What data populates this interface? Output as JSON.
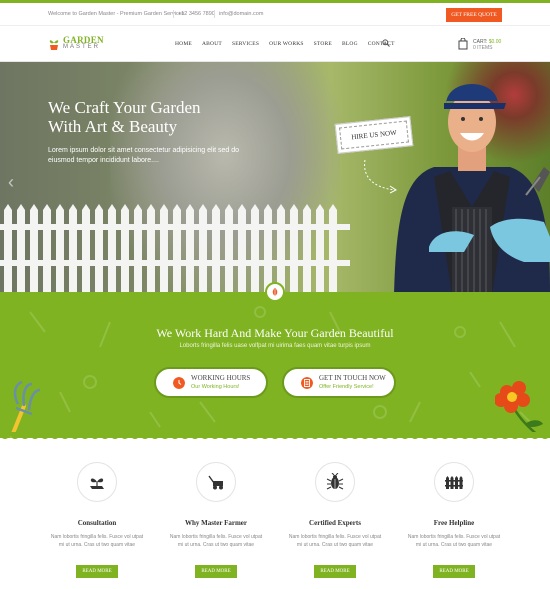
{
  "topbar": {
    "welcome": "Welcome to Garden Master - Premium Garden Services",
    "phone": "+12 3456 7890",
    "email": "info@domain.com",
    "quote_button": "GET FREE QUOTE"
  },
  "header": {
    "logo_line1": "GARDEN",
    "logo_line2": "MASTER",
    "nav": [
      "HOME",
      "ABOUT",
      "SERVICES",
      "OUR WORKS",
      "STORE",
      "BLOG",
      "CONTACT"
    ],
    "cart_label": "CART:",
    "cart_amount": "$0.00",
    "cart_items": "0 ITEMS"
  },
  "hero": {
    "title_line1": "We Craft Your Garden",
    "title_line2": "With Art & Beauty",
    "text": "Lorem ipsum dolor sit amet consectetur adipisicing elit sed do eiusmod tempor incididunt labore....",
    "hire_button": "HIRE US NOW"
  },
  "band": {
    "heading": "We Work Hard And Make Your Garden Beautiful",
    "sub": "Loborts fringilla felis uase volfpat mi uirima faes quam vitae turpis ipsum",
    "hours_title": "WORKING HOURS",
    "hours_sub": "Our Working Hours!",
    "touch_title": "GET IN TOUCH NOW",
    "touch_sub": "Offer Friendly Service!"
  },
  "features": [
    {
      "title": "Consultation",
      "text": "Nam lobortis fringilla felis. Fusce vol utpat mi ut urna. Cras ut two quam vitae",
      "button": "READ MORE",
      "icon": "plant-hand-icon"
    },
    {
      "title": "Why Master Farmer",
      "text": "Nam lobortis fringilla felis. Fusce vol utpat mi ut urna. Cras ut two quam vitae",
      "button": "READ MORE",
      "icon": "lawnmower-icon"
    },
    {
      "title": "Certified Experts",
      "text": "Nam lobortis fringilla felis. Fusce vol utpat mi ut urna. Cras ut two quam vitae",
      "button": "READ MORE",
      "icon": "bug-icon"
    },
    {
      "title": "Free Helpline",
      "text": "Nam lobortis fringilla felis. Fusce vol utpat mi ut urna. Cras ut two quam vitae",
      "button": "READ MORE",
      "icon": "fence-icon"
    }
  ],
  "colors": {
    "green": "#7fb321",
    "orange": "#f05a22"
  }
}
